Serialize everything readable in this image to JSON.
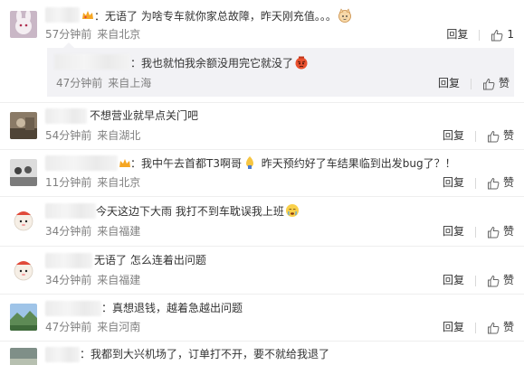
{
  "comments": [
    {
      "text": "：无语了 为啥专车就你家总故障，昨天刚充值。。。",
      "time": "57分钟前",
      "source": "来自北京",
      "reply_label": "回复",
      "like_count": "1",
      "reply": {
        "text": "：我也就怕我余额没用完它就没了",
        "time": "47分钟前",
        "source": "来自上海",
        "reply_label": "回复",
        "like_label": "赞"
      }
    },
    {
      "text": "不想营业就早点关门吧",
      "time": "54分钟前",
      "source": "来自湖北",
      "reply_label": "回复",
      "like_label": "赞"
    },
    {
      "text": "：我中午去首都T3啊哥",
      "text2": "昨天预约好了车结果临到出发bug了？！",
      "time": "11分钟前",
      "source": "来自北京",
      "reply_label": "回复",
      "like_label": "赞"
    },
    {
      "text": "今天这边下大雨 我打不到车耽误我上班",
      "time": "34分钟前",
      "source": "来自福建",
      "reply_label": "回复",
      "like_label": "赞"
    },
    {
      "text": "无语了 怎么连着出问题",
      "time": "34分钟前",
      "source": "来自福建",
      "reply_label": "回复",
      "like_label": "赞"
    },
    {
      "text": "：真想退钱，越着急越出问题",
      "time": "47分钟前",
      "source": "来自河南",
      "reply_label": "回复",
      "like_label": "赞"
    },
    {
      "text": "：我都到大兴机场了，订单打不开，要不就给我退了"
    }
  ],
  "colors": {
    "text": "#333333",
    "meta": "#808080",
    "reply_bg": "#f2f2f5",
    "divider": "#eeeeee"
  }
}
